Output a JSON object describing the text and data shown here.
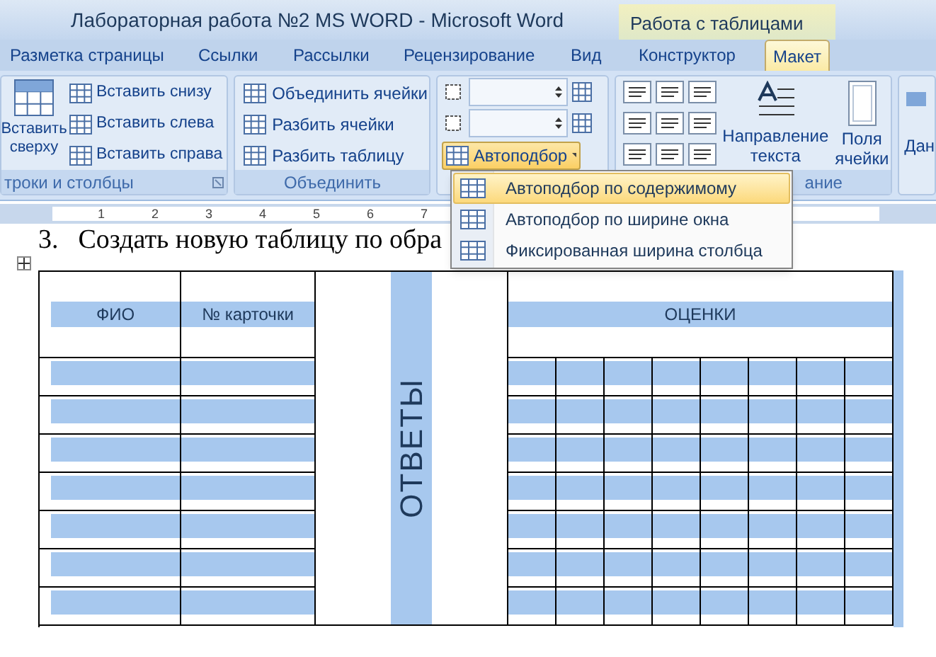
{
  "window": {
    "title": "Лабораторная работа №2 MS WORD - Microsoft Word",
    "context_title": "Работа с таблицами"
  },
  "tabs": [
    {
      "label": "Разметка страницы",
      "selected": false
    },
    {
      "label": "Ссылки",
      "selected": false
    },
    {
      "label": "Рассылки",
      "selected": false
    },
    {
      "label": "Рецензирование",
      "selected": false
    },
    {
      "label": "Вид",
      "selected": false
    },
    {
      "label": "Конструктор",
      "selected": false
    },
    {
      "label": "Макет",
      "selected": true
    }
  ],
  "ribbon": {
    "rows_columns": {
      "large_button": "Вставить сверху",
      "buttons": [
        "Вставить снизу",
        "Вставить слева",
        "Вставить справа"
      ],
      "label": "троки и столбцы"
    },
    "merge": {
      "buttons": [
        "Объединить ячейки",
        "Разбить ячейки",
        "Разбить таблицу"
      ],
      "label": "Объединить"
    },
    "cell_size": {
      "autofit": {
        "label": "Автоподбор",
        "expanded": true
      }
    },
    "alignment": {
      "text_direction": "Направление текста",
      "cell_margins": "Поля ячейки",
      "label": "ание"
    },
    "data": {
      "label": "Дан"
    }
  },
  "ruler": [
    "1",
    "2",
    "3",
    "4",
    "5",
    "6",
    "7"
  ],
  "menu": [
    {
      "label": "Автоподбор по содержимому",
      "selected": true
    },
    {
      "label": "Автоподбор по ширине окна",
      "selected": false
    },
    {
      "label": "Фиксированная ширина столбца",
      "selected": false
    }
  ],
  "document": {
    "number": "3.",
    "text": "Создать новую таблицу по обра"
  },
  "table": {
    "headers": [
      "ФИО",
      "№ карточки"
    ],
    "answers": "ОТВЕТЫ",
    "grades": "ОЦЕНКИ"
  }
}
